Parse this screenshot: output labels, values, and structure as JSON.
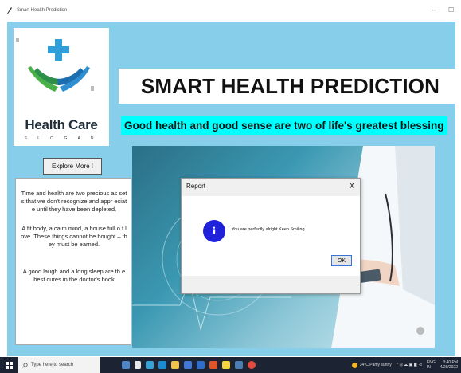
{
  "window": {
    "title": "Smart Health Prediction",
    "minimize_glyph": "–",
    "maximize_glyph": "☐"
  },
  "logo": {
    "brand": "Health Care",
    "slogan": "S L O G A N"
  },
  "header": {
    "title": "SMART HEALTH PREDICTION",
    "tagline": "Good health and good sense are two of life's greatest blessing"
  },
  "sidebar": {
    "explore_label": "Explore More !",
    "quotes": [
      "Time and health are two precious as sets that we don't recognize and appr eciate until they have been depleted.",
      "A fit body, a calm mind, a house full o f love. These things cannot be bought – they must be earned.",
      "A good laugh and a long sleep are th e best cures in the doctor's book"
    ]
  },
  "dialog": {
    "title": "Report",
    "close": "X",
    "icon_letter": "i",
    "message": "You are perfectly  alright Keep Smiling",
    "ok_label": "OK"
  },
  "taskbar": {
    "search_placeholder": "Type here to search",
    "weather": "34°C  Partly sunny",
    "lang": "ENG\nIN",
    "time": "3:40 PM",
    "date": "4/29/2022"
  },
  "colors": {
    "client_bg": "#87ceeb",
    "tagline_bg": "#00ffff",
    "info_icon": "#1f22d8",
    "taskbar": "#1c2333"
  }
}
